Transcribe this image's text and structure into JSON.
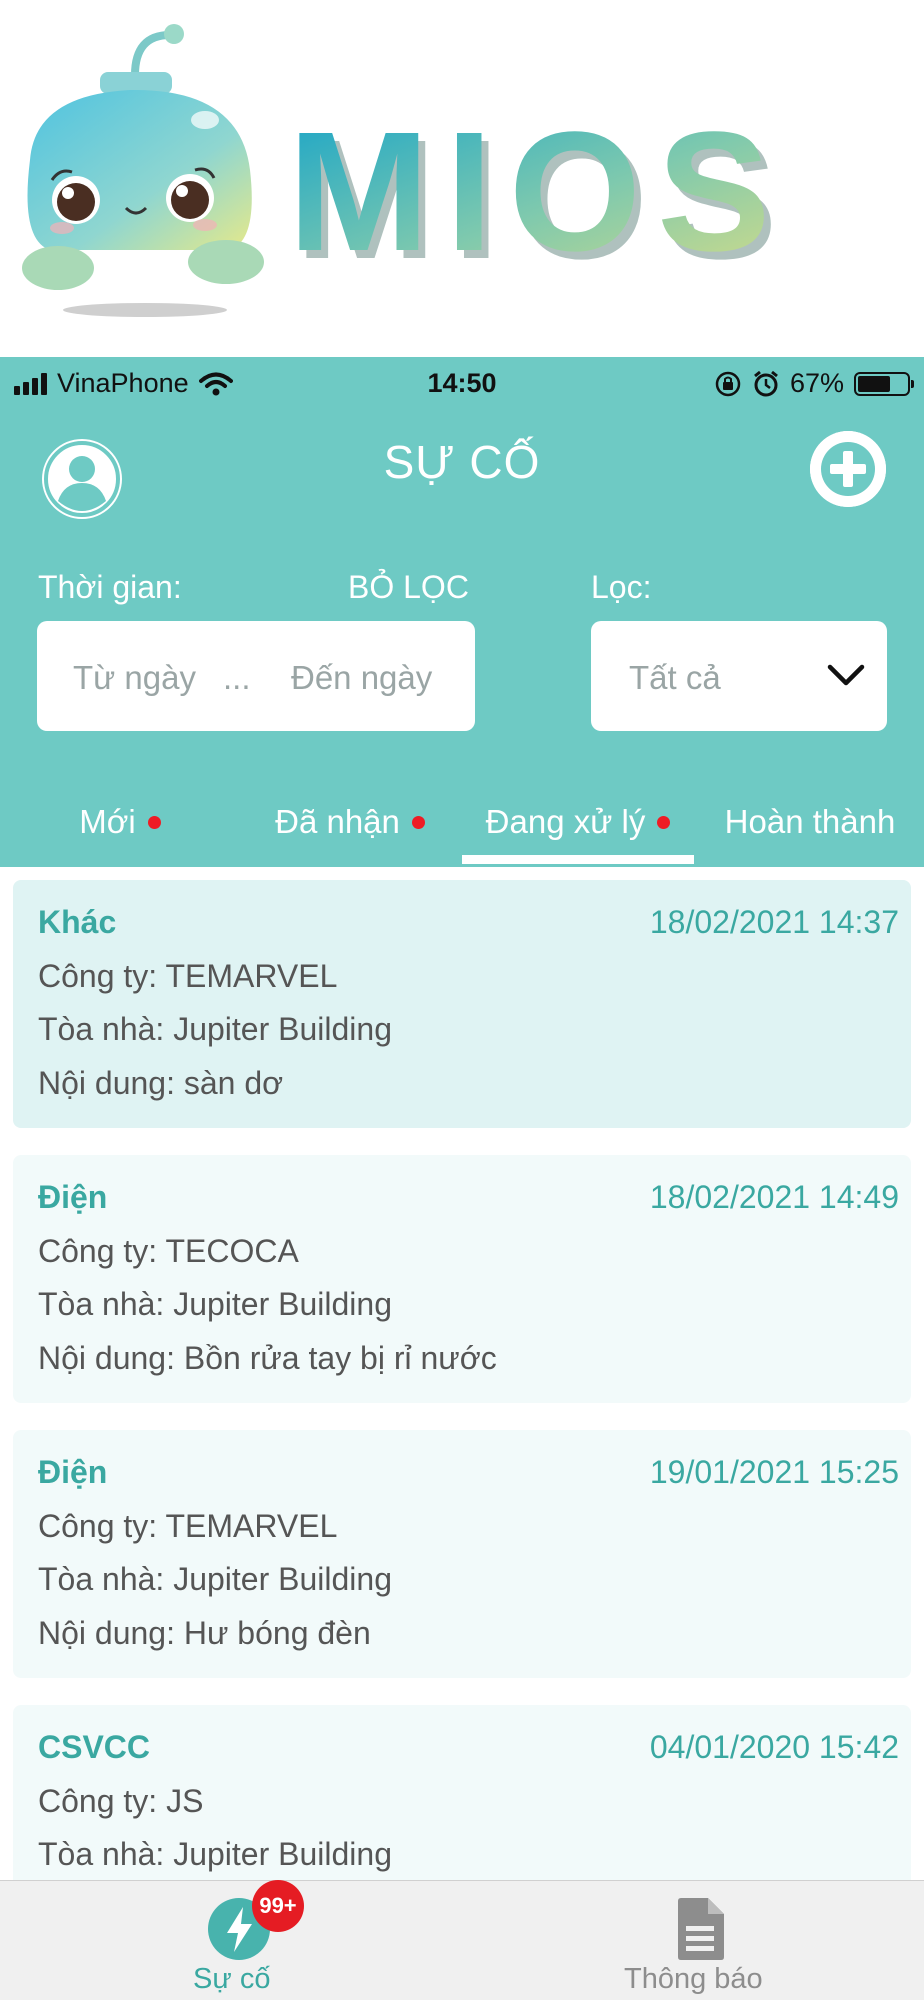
{
  "logo": {
    "text": "MIOS"
  },
  "status_bar": {
    "carrier": "VinaPhone",
    "time": "14:50",
    "battery_percent": "67%",
    "battery_level": 0.67
  },
  "header": {
    "title": "SỰ CỐ",
    "time_label": "Thời gian:",
    "clear_filter": "BỎ LỌC",
    "filter_label": "Lọc:",
    "from_date_placeholder": "Từ ngày",
    "range_separator": "...",
    "to_date_placeholder": "Đến ngày",
    "filter_value": "Tất cả"
  },
  "tabs": [
    {
      "label": "Mới",
      "has_dot": true
    },
    {
      "label": "Đã nhận",
      "has_dot": true
    },
    {
      "label": "Đang xử lý",
      "has_dot": true,
      "selected": true
    },
    {
      "label": "Hoàn thành",
      "has_dot": false
    }
  ],
  "incidents": [
    {
      "type": "Khác",
      "datetime": "18/02/2021 14:37",
      "company": "Công ty: TEMARVEL",
      "building": "Tòa nhà: Jupiter Building",
      "content": "Nội dung: sàn dơ"
    },
    {
      "type": "Điện",
      "datetime": "18/02/2021 14:49",
      "company": "Công ty: TECOCA",
      "building": "Tòa nhà: Jupiter Building",
      "content": "Nội dung: Bồn rửa tay bị rỉ nước"
    },
    {
      "type": "Điện",
      "datetime": "19/01/2021 15:25",
      "company": "Công ty: TEMARVEL",
      "building": "Tòa nhà: Jupiter Building",
      "content": "Nội dung: Hư bóng đèn"
    },
    {
      "type": "CSVCC",
      "datetime": "04/01/2020 15:42",
      "company": "Công ty: JS",
      "building": "Tòa nhà: Jupiter Building",
      "content": ""
    }
  ],
  "bottom_nav": {
    "incidents_label": "Sự cố",
    "notifications_label": "Thông báo",
    "badge": "99+"
  },
  "colors": {
    "header_teal": "#6ecac4",
    "accent_text": "#3aa8a1",
    "badge_red": "#e51c23",
    "active_card": "#dff3f3"
  },
  "icons": {
    "avatar": "user-circle-icon",
    "add": "plus-circle-icon",
    "dropdown": "chevron-down-icon",
    "nav_incidents": "lightning-icon",
    "nav_notifications": "document-icon"
  }
}
